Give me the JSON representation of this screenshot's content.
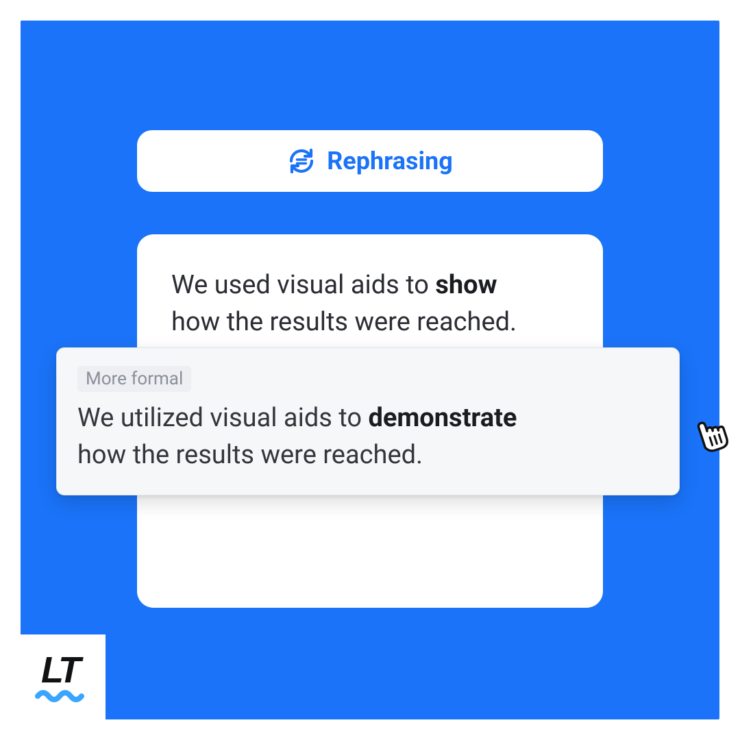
{
  "colors": {
    "accent": "#1a73f8",
    "panel_bg": "#f6f7f9",
    "panel_border": "#e1e4ea",
    "tag_bg": "#edeff3",
    "tag_text": "#8a8f99",
    "logo_dark": "#111213",
    "logo_wave": "#3aa5ff"
  },
  "header": {
    "label": "Rephrasing",
    "icon": "rephrase-icon"
  },
  "original": {
    "line1_pre": "We used visual aids to ",
    "line1_bold": "show",
    "line2": "how the results were reached."
  },
  "suggestion": {
    "tag": "More formal",
    "line1_pre": "We utilized visual aids to ",
    "line1_bold": "demonstrate",
    "line2": "how the results were reached."
  },
  "logo": {
    "text": "LT"
  }
}
